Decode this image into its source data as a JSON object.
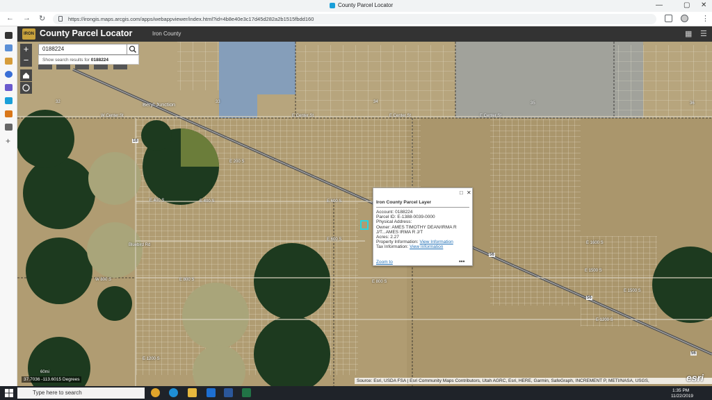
{
  "browser": {
    "tab_title": "County Parcel Locator",
    "url": "https://irongis.maps.arcgis.com/apps/webappviewer/index.html?id=4b8e40e3c17d45d282a2b1515fbdd160",
    "window_controls": [
      "—",
      "▢",
      "✕"
    ]
  },
  "app": {
    "logo_text": "IRON",
    "title": "County Parcel Locator",
    "subtitle": "Iron County"
  },
  "search": {
    "value": "0188224",
    "suggestion_prefix": "Show search results for",
    "suggestion_value": "0188224"
  },
  "map_labels": {
    "place": "Beryl Junction",
    "sections": [
      "32",
      "33",
      "34",
      "35",
      "36"
    ],
    "roads": [
      "E Center St",
      "E Center St",
      "E Center St",
      "W Center St",
      "E 200 S",
      "E 400 S",
      "E 400 S",
      "E 600 S",
      "E 600 S",
      "E 800 S",
      "E 800 S",
      "W 800 S",
      "E 1600 S",
      "E 1200 S",
      "E 1200 S",
      "Bluebird Rd",
      "E 1500 S",
      "E 1500 S"
    ],
    "highways": [
      "18",
      "56",
      "56",
      "56"
    ]
  },
  "popup": {
    "layer": "Iron County Parcel Layer",
    "account_label": "Account:",
    "account_value": "0188224",
    "parcel_label": "Parcel ID:",
    "parcel_value": "E-1388-0039-0000",
    "address_label": "Physical Address:",
    "address_value": "",
    "owner_label": "Owner:",
    "owner_value": "AMES TIMOTHY DEAN/IRMA R",
    "owner_value_line2": "J/T...AMES IRMA R J/T",
    "acres_label": "Acres:",
    "acres_value": "2.27",
    "property_label": "Property Information:",
    "property_link": "View Information",
    "tax_label": "Tax Information:",
    "tax_link": "View Information",
    "zoom_label": "Zoom to",
    "more_label": "•••"
  },
  "coordinates": "37.7036 -113.6015 Degrees",
  "scale_label": "60mi",
  "attribution": "Source: Esri, USDA FSA | Esri Community Maps Contributors, Utah AGRC, Esri, HERE, Garmin, SafeGraph, INCREMENT P, METI/NASA, USGS,",
  "esri_logo": "esri",
  "taskbar": {
    "search_placeholder": "Type here to search",
    "time": "1:35 PM",
    "date": "11/22/2019"
  },
  "colors": {
    "app_header": "#333333",
    "map_ground": "#b5a27a",
    "field_green": "#1d3a1f",
    "water_blue": "#7d9cc4",
    "link_blue": "#1f6fb6",
    "highlight_cyan": "#00e5ff"
  }
}
